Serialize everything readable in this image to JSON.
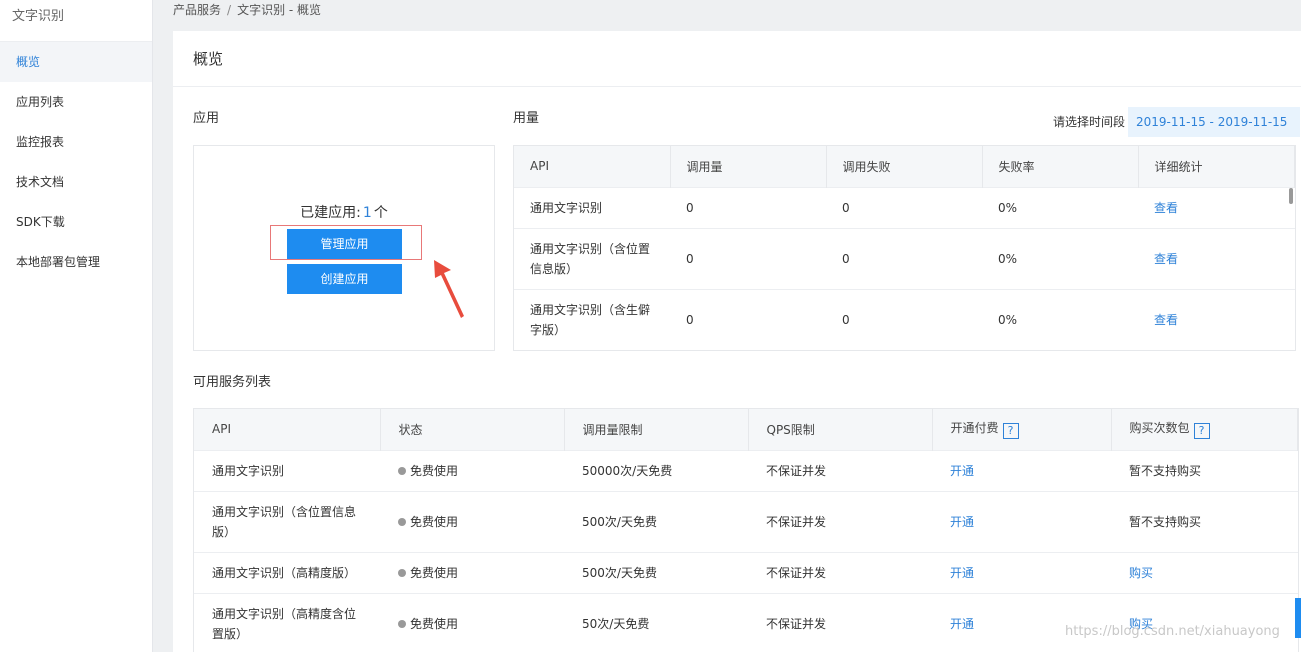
{
  "sidebar": {
    "title": "文字识别",
    "items": [
      {
        "label": "概览"
      },
      {
        "label": "应用列表"
      },
      {
        "label": "监控报表"
      },
      {
        "label": "技术文档"
      },
      {
        "label": "SDK下载"
      },
      {
        "label": "本地部署包管理"
      }
    ]
  },
  "breadcrumb": {
    "parent": "产品服务",
    "separator": "/",
    "current": "文字识别 - 概览"
  },
  "page": {
    "title": "概览"
  },
  "apps": {
    "section_title": "应用",
    "count_prefix": "已建应用:",
    "count": "1",
    "count_suffix": "个",
    "manage_button": "管理应用",
    "create_button": "创建应用"
  },
  "usage": {
    "section_title": "用量",
    "date_label": "请选择时间段",
    "date_range": "2019-11-15 - 2019-11-15",
    "columns": [
      "API",
      "调用量",
      "调用失败",
      "失败率",
      "详细统计"
    ],
    "rows": [
      {
        "api": "通用文字识别",
        "calls": "0",
        "failures": "0",
        "rate": "0%",
        "detail": "查看"
      },
      {
        "api": "通用文字识别（含位置信息版）",
        "calls": "0",
        "failures": "0",
        "rate": "0%",
        "detail": "查看"
      },
      {
        "api": "通用文字识别（含生僻字版）",
        "calls": "0",
        "failures": "0",
        "rate": "0%",
        "detail": "查看"
      }
    ]
  },
  "services": {
    "section_title": "可用服务列表",
    "columns": [
      "API",
      "状态",
      "调用量限制",
      "QPS限制",
      "开通付费",
      "购买次数包"
    ],
    "help_mark": "?",
    "rows": [
      {
        "api": "通用文字识别",
        "status": "免费使用",
        "limit": "50000次/天免费",
        "qps": "不保证并发",
        "pay": "开通",
        "pack": "暂不支持购买"
      },
      {
        "api": "通用文字识别（含位置信息版）",
        "status": "免费使用",
        "limit": "500次/天免费",
        "qps": "不保证并发",
        "pay": "开通",
        "pack": "暂不支持购买"
      },
      {
        "api": "通用文字识别（高精度版）",
        "status": "免费使用",
        "limit": "500次/天免费",
        "qps": "不保证并发",
        "pay": "开通",
        "pack": "购买"
      },
      {
        "api": "通用文字识别（高精度含位置版）",
        "status": "免费使用",
        "limit": "50次/天免费",
        "qps": "不保证并发",
        "pay": "开通",
        "pack": "购买"
      }
    ]
  },
  "watermark": "https://blog.csdn.net/xiahuayong",
  "colors": {
    "accent": "#1e8cf0",
    "link": "#2f82d8",
    "highlight": "#e87878"
  }
}
